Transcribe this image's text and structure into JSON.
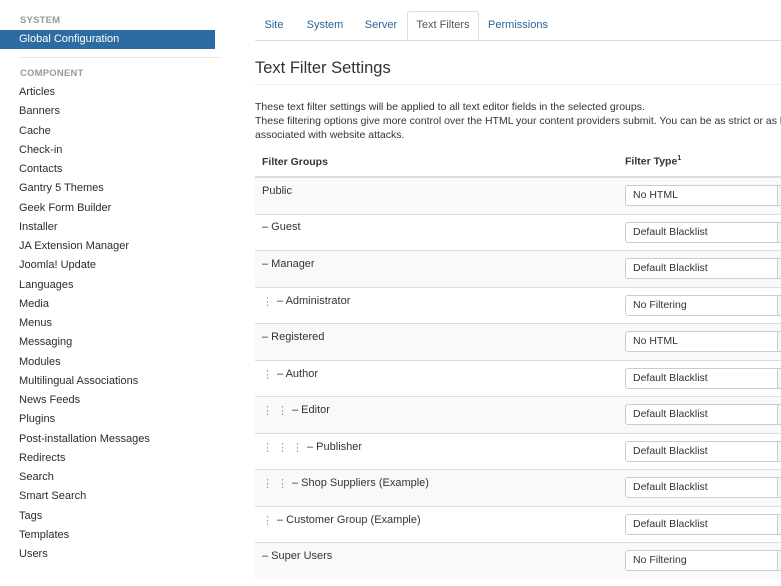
{
  "sidebar": {
    "system_header": "SYSTEM",
    "active_item": "Global Configuration",
    "component_header": "COMPONENT",
    "items": [
      "Articles",
      "Banners",
      "Cache",
      "Check-in",
      "Contacts",
      "Gantry 5 Themes",
      "Geek Form Builder",
      "Installer",
      "JA Extension Manager",
      "Joomla! Update",
      "Languages",
      "Media",
      "Menus",
      "Messaging",
      "Modules",
      "Multilingual Associations",
      "News Feeds",
      "Plugins",
      "Post-installation Messages",
      "Redirects",
      "Search",
      "Smart Search",
      "Tags",
      "Templates",
      "Users"
    ]
  },
  "tabs": [
    "Site",
    "System",
    "Server",
    "Text Filters",
    "Permissions"
  ],
  "active_tab": "Text Filters",
  "heading": "Text Filter Settings",
  "description": [
    "These text filter settings will be applied to all text editor fields in the selected groups.",
    "These filtering options give more control over the HTML your content providers submit. You can be as strict or as l",
    "associated with website attacks."
  ],
  "table": {
    "col_groups": "Filter Groups",
    "col_type": "Filter Type",
    "col_type_sup": "1",
    "rows": [
      {
        "indent": 0,
        "label": "Public",
        "filter": "No HTML"
      },
      {
        "indent": 0,
        "label": "– Guest",
        "filter": "Default Blacklist"
      },
      {
        "indent": 0,
        "label": "– Manager",
        "filter": "Default Blacklist"
      },
      {
        "indent": 1,
        "label": "– Administrator",
        "filter": "No Filtering"
      },
      {
        "indent": 0,
        "label": "– Registered",
        "filter": "No HTML"
      },
      {
        "indent": 1,
        "label": "– Author",
        "filter": "Default Blacklist"
      },
      {
        "indent": 2,
        "label": "– Editor",
        "filter": "Default Blacklist"
      },
      {
        "indent": 3,
        "label": "– Publisher",
        "filter": "Default Blacklist"
      },
      {
        "indent": 2,
        "label": "– Shop Suppliers (Example)",
        "filter": "Default Blacklist"
      },
      {
        "indent": 1,
        "label": "– Customer Group (Example)",
        "filter": "Default Blacklist"
      },
      {
        "indent": 0,
        "label": "– Super Users",
        "filter": "No Filtering"
      }
    ]
  },
  "colors": {
    "accent": "#2d6ca2",
    "link": "#2a6496"
  },
  "icons": {
    "select_caret": "caret-down-icon",
    "indent_marker": "vertical-dots-icon"
  }
}
